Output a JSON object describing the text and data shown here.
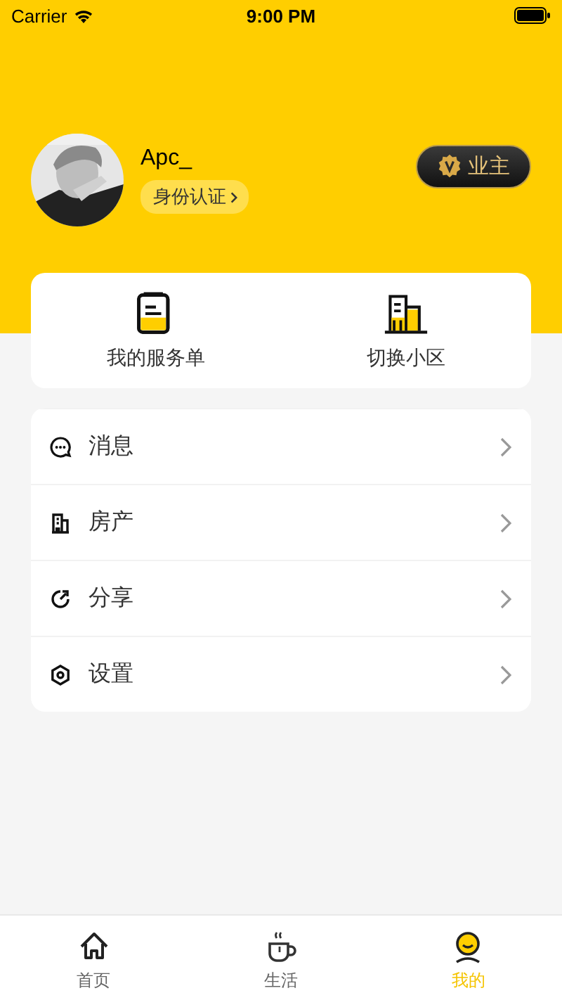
{
  "status_bar": {
    "carrier": "Carrier",
    "time": "9:00 PM"
  },
  "profile": {
    "name": "Apc_",
    "verify_label": "身份认证",
    "role_badge": "业主"
  },
  "shortcuts": [
    {
      "label": "我的服务单",
      "kind": "order"
    },
    {
      "label": "切换小区",
      "kind": "building"
    }
  ],
  "menu": [
    {
      "label": "消息",
      "kind": "message"
    },
    {
      "label": "房产",
      "kind": "property"
    },
    {
      "label": "分享",
      "kind": "share"
    },
    {
      "label": "设置",
      "kind": "settings"
    }
  ],
  "tabs": [
    {
      "label": "首页",
      "kind": "home",
      "selected": false
    },
    {
      "label": "生活",
      "kind": "life",
      "selected": false
    },
    {
      "label": "我的",
      "kind": "mine",
      "selected": true
    }
  ]
}
